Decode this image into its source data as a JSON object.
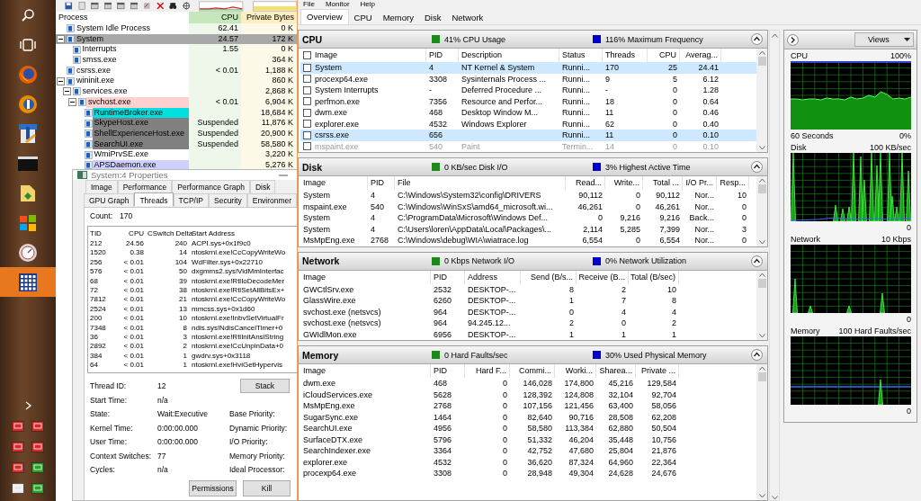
{
  "taskbar": {
    "items": [
      {
        "kind": "search",
        "selected": false
      },
      {
        "kind": "task-view",
        "selected": false
      },
      {
        "kind": "globe",
        "selected": false
      },
      {
        "kind": "round-logo",
        "selected": false
      },
      {
        "kind": "document",
        "selected": false
      },
      {
        "kind": "terminal",
        "selected": false
      },
      {
        "kind": "folder",
        "selected": false
      },
      {
        "kind": "tiles",
        "selected": false
      },
      {
        "kind": "circle",
        "selected": false
      },
      {
        "kind": "grid",
        "selected": true
      }
    ]
  },
  "process_explorer": {
    "columns": [
      "Process",
      "CPU",
      "Private Bytes"
    ],
    "processes": [
      {
        "name": "System Idle Process",
        "cpu": "62.41",
        "private_bytes": "0 K",
        "selected": false
      },
      {
        "name": "System",
        "cpu": "24.57",
        "private_bytes": "172 K",
        "selected": true,
        "expanded": true,
        "children": [
          {
            "name": "Interrupts",
            "cpu": "1.55",
            "private_bytes": "0 K",
            "selected": false
          },
          {
            "name": "smss.exe",
            "private_bytes": "364 K",
            "selected": false
          }
        ]
      },
      {
        "name": "csrss.exe",
        "cpu": "< 0.01",
        "private_bytes": "1,188 K",
        "selected": false
      },
      {
        "name": "wininit.exe",
        "private_bytes": "860 K",
        "selected": false,
        "expanded": true,
        "children": [
          {
            "name": "services.exe",
            "private_bytes": "2,868 K",
            "selected": false,
            "expanded": true,
            "children": [
              {
                "name": "svchost.exe",
                "cpu": "< 0.01",
                "private_bytes": "6,904 K",
                "selected": false,
                "color": "#ffd0d0",
                "expanded": true,
                "children": [
                  {
                    "name": "RuntimeBroker.exe",
                    "private_bytes": "18,684 K",
                    "selected": false,
                    "color": "#00e0e0"
                  },
                  {
                    "name": "SkypeHost.exe",
                    "cpu": "Suspended",
                    "private_bytes": "11,876 K",
                    "selected": false,
                    "color": "#808080"
                  },
                  {
                    "name": "ShellExperienceHost.exe",
                    "cpu": "Suspended",
                    "private_bytes": "20,900 K",
                    "selected": false,
                    "color": "#808080"
                  },
                  {
                    "name": "SearchUI.exe",
                    "cpu": "Suspended",
                    "private_bytes": "58,580 K",
                    "selected": false,
                    "color": "#808080"
                  },
                  {
                    "name": "WmiPrvSE.exe",
                    "private_bytes": "3,220 K",
                    "selected": false
                  },
                  {
                    "name": "APSDaemon.exe",
                    "private_bytes": "5,276 K",
                    "selected": false,
                    "color": "#d0d0ff"
                  }
                ]
              }
            ]
          }
        ]
      }
    ]
  },
  "properties_dialog": {
    "title": "System:4 Properties",
    "tab_rows": [
      [
        {
          "label": "Image",
          "selected": false
        },
        {
          "label": "Performance",
          "selected": false
        },
        {
          "label": "Performance Graph",
          "selected": false
        },
        {
          "label": "Disk",
          "selected": false
        }
      ],
      [
        {
          "label": "GPU Graph",
          "selected": false
        },
        {
          "label": "Threads",
          "selected": true
        },
        {
          "label": "TCP/IP",
          "selected": false
        },
        {
          "label": "Security",
          "selected": false
        },
        {
          "label": "Environmer",
          "selected": false
        }
      ]
    ],
    "count_label": "Count:",
    "count": "170",
    "thread_columns": [
      "TID",
      "CPU",
      "CSwitch Delta",
      "Start Address"
    ],
    "threads": [
      [
        "212",
        "24.56",
        "240",
        "ACPI.sys+0x1f9c0"
      ],
      [
        "1520",
        "0.38",
        "14",
        "ntoskrnl.exe!CcCopyWriteWo"
      ],
      [
        "256",
        "< 0.01",
        "104",
        "WdFilter.sys+0x22710"
      ],
      [
        "576",
        "< 0.01",
        "50",
        "dxgmms2.sys!VidMmInterfac"
      ],
      [
        "68",
        "< 0.01",
        "39",
        "ntoskrnl.exe!RtlIoDecodeMer"
      ],
      [
        "72",
        "< 0.01",
        "38",
        "ntoskrnl.exe!RtlSetAllBitsEx+"
      ],
      [
        "7812",
        "< 0.01",
        "21",
        "ntoskrnl.exe!CcCopyWriteWo"
      ],
      [
        "2524",
        "< 0.01",
        "13",
        "mmcss.sys+0x1d60"
      ],
      [
        "200",
        "< 0.01",
        "10",
        "ntoskrnl.exe!InbvSetVirtualFr"
      ],
      [
        "7348",
        "< 0.01",
        "8",
        "ndis.sys!NdisCancelTimer+0"
      ],
      [
        "36",
        "< 0.01",
        "3",
        "ntoskrnl.exe!RtlInitAnsiString"
      ],
      [
        "2892",
        "< 0.01",
        "2",
        "ntoskrnl.exe!CcUnpinData+0"
      ],
      [
        "384",
        "< 0.01",
        "1",
        "gwdrv.sys+0x3118"
      ],
      [
        "64",
        "< 0.01",
        "1",
        "ntoskrnl.exe!HviGetHypervis"
      ]
    ],
    "details": [
      {
        "label": "Thread ID:",
        "value": "12"
      },
      {
        "label": "Start Time:",
        "value": "n/a"
      },
      {
        "label": "State:",
        "value": "Wait:Executive"
      },
      {
        "label": "Kernel Time:",
        "value": "0:00:00.000"
      },
      {
        "label": "User Time:",
        "value": "0:00:00.000"
      },
      {
        "label": "Context Switches:",
        "value": "77"
      },
      {
        "label": "Cycles:",
        "value": "n/a"
      }
    ],
    "priority_labels": [
      "Base Priority:",
      "Dynamic Priority:",
      "I/O Priority:",
      "Memory Priority:",
      "Ideal Processor:"
    ],
    "stack_button": "Stack",
    "buttons": [
      "Permissions",
      "Kill"
    ]
  },
  "resource_monitor": {
    "menu": [
      "File",
      "Monitor",
      "Help"
    ],
    "tabs": [
      {
        "label": "Overview",
        "selected": true
      },
      {
        "label": "CPU",
        "selected": false
      },
      {
        "label": "Memory",
        "selected": false
      },
      {
        "label": "Disk",
        "selected": false
      },
      {
        "label": "Network",
        "selected": false
      }
    ],
    "sections": [
      {
        "kind": "cpu",
        "title": "CPU",
        "expanded": true,
        "header_checked": false,
        "indicators": [
          {
            "label": "41% CPU Usage",
            "color": "#1a8a1a"
          },
          {
            "label": "116% Maximum Frequency",
            "color": "#0000c8"
          }
        ],
        "columns": [
          "Image",
          "PID",
          "Description",
          "Status",
          "Threads",
          "CPU",
          "Averag..."
        ],
        "rows": [
          {
            "cells": [
              "System",
              "4",
              "NT Kernel & System",
              "Runni...",
              "170",
              "25",
              "24.41"
            ],
            "checked": false,
            "selected": true,
            "dimmed": false
          },
          {
            "cells": [
              "procexp64.exe",
              "3308",
              "Sysinternals Process ...",
              "Runni...",
              "9",
              "5",
              "6.12"
            ],
            "checked": false,
            "selected": false,
            "dimmed": false
          },
          {
            "cells": [
              "System Interrupts",
              "-",
              "Deferred Procedure ...",
              "Runni...",
              "-",
              "0",
              "1.28"
            ],
            "checked": false,
            "selected": false,
            "dimmed": false
          },
          {
            "cells": [
              "perfmon.exe",
              "7356",
              "Resource and Perfor...",
              "Runni...",
              "18",
              "0",
              "0.64"
            ],
            "checked": false,
            "selected": false,
            "dimmed": false
          },
          {
            "cells": [
              "dwm.exe",
              "468",
              "Desktop Window M...",
              "Runni...",
              "11",
              "0",
              "0.46"
            ],
            "checked": false,
            "selected": false,
            "dimmed": false
          },
          {
            "cells": [
              "explorer.exe",
              "4532",
              "Windows Explorer",
              "Runni...",
              "62",
              "0",
              "0.40"
            ],
            "checked": false,
            "selected": false,
            "dimmed": false
          },
          {
            "cells": [
              "csrss.exe",
              "656",
              null,
              "Runni...",
              "11",
              "0",
              "0.10"
            ],
            "checked": false,
            "selected": true,
            "dimmed": false
          },
          {
            "cells": [
              "mspaint.exe",
              "540",
              "Paint",
              "Termin...",
              "14",
              "0",
              "0.10"
            ],
            "checked": false,
            "selected": false,
            "dimmed": true
          }
        ]
      },
      {
        "kind": "disk",
        "title": "Disk",
        "expanded": true,
        "indicators": [
          {
            "label": "0 KB/sec Disk I/O",
            "color": "#1a8a1a"
          },
          {
            "label": "3% Highest Active Time",
            "color": "#0000c8"
          }
        ],
        "columns": [
          "Image",
          "PID",
          "File",
          "Read...",
          "Write...",
          "Total ...",
          "I/O Pr...",
          "Resp..."
        ],
        "rows": [
          {
            "cells": [
              "System",
              "4",
              "C:\\Windows\\System32\\config\\DRIVERS",
              "90,112",
              "0",
              "90,112",
              "Nor...",
              "10"
            ]
          },
          {
            "cells": [
              "mspaint.exe",
              "540",
              "C:\\Windows\\WinSxS\\amd64_microsoft.wi...",
              "46,261",
              "0",
              "46,261",
              "Nor...",
              "0"
            ]
          },
          {
            "cells": [
              "System",
              "4",
              "C:\\ProgramData\\Microsoft\\Windows Def...",
              "0",
              "9,216",
              "9,216",
              "Back...",
              "0"
            ]
          },
          {
            "cells": [
              "System",
              "4",
              "C:\\Users\\loren\\AppData\\Local\\Packages\\...",
              "2,114",
              "5,285",
              "7,399",
              "Nor...",
              "3"
            ]
          },
          {
            "cells": [
              "MsMpEng.exe",
              "2768",
              "C:\\Windows\\debug\\WIA\\wiatrace.log",
              "6,554",
              "0",
              "6,554",
              "Nor...",
              "0"
            ]
          }
        ]
      },
      {
        "kind": "network",
        "title": "Network",
        "expanded": true,
        "indicators": [
          {
            "label": "0 Kbps Network I/O",
            "color": "#1a8a1a"
          },
          {
            "label": "0% Network Utilization",
            "color": "#0000c8"
          }
        ],
        "columns": [
          "Image",
          "PID",
          "Address",
          "Send (B/s...",
          "Receive (B...",
          "Total (B/sec)"
        ],
        "rows": [
          {
            "cells": [
              "GWCtlSrv.exe",
              "2532",
              "DESKTOP-...",
              "8",
              "2",
              "10"
            ]
          },
          {
            "cells": [
              "GlassWire.exe",
              "6260",
              "DESKTOP-...",
              "1",
              "7",
              "8"
            ]
          },
          {
            "cells": [
              "svchost.exe (netsvcs)",
              "964",
              "DESKTOP-...",
              "0",
              "4",
              "4"
            ]
          },
          {
            "cells": [
              "svchost.exe (netsvcs)",
              "964",
              "94.245.12...",
              "2",
              "0",
              "2"
            ]
          },
          {
            "cells": [
              "GWIdlMon.exe",
              "6956",
              "DESKTOP-...",
              "1",
              "1",
              "1"
            ]
          }
        ]
      },
      {
        "kind": "memory",
        "title": "Memory",
        "expanded": true,
        "indicators": [
          {
            "label": "0 Hard Faults/sec",
            "color": "#1a8a1a"
          },
          {
            "label": "30% Used Physical Memory",
            "color": "#0000c8"
          }
        ],
        "columns": [
          "Image",
          "PID",
          "Hard F...",
          "Commi...",
          "Worki...",
          "Sharea...",
          "Private ..."
        ],
        "rows": [
          {
            "cells": [
              "dwm.exe",
              "468",
              "0",
              "146,028",
              "174,800",
              "45,216",
              "129,584"
            ]
          },
          {
            "cells": [
              "iCloudServices.exe",
              "5628",
              "0",
              "128,392",
              "124,808",
              "32,104",
              "92,704"
            ]
          },
          {
            "cells": [
              "MsMpEng.exe",
              "2768",
              "0",
              "107,156",
              "121,456",
              "63,400",
              "58,056"
            ]
          },
          {
            "cells": [
              "SugarSync.exe",
              "1464",
              "0",
              "82,640",
              "90,716",
              "28,508",
              "62,208"
            ]
          },
          {
            "cells": [
              "SearchUI.exe",
              "4956",
              "0",
              "58,580",
              "113,384",
              "62,880",
              "50,504"
            ]
          },
          {
            "cells": [
              "SurfaceDTX.exe",
              "5796",
              "0",
              "51,332",
              "46,204",
              "35,448",
              "10,756"
            ]
          },
          {
            "cells": [
              "SearchIndexer.exe",
              "3364",
              "0",
              "42,752",
              "47,680",
              "25,804",
              "21,876"
            ]
          },
          {
            "cells": [
              "explorer.exe",
              "4532",
              "0",
              "36,620",
              "87,324",
              "64,960",
              "22,364"
            ]
          },
          {
            "cells": [
              "procexp64.exe",
              "3308",
              "0",
              "28,948",
              "49,304",
              "24,628",
              "24,676"
            ]
          }
        ]
      }
    ],
    "views_button": "Views",
    "graphs": [
      {
        "kind": "cpu",
        "title": "CPU",
        "max": "100%",
        "time": "60 Seconds",
        "min": "0%"
      },
      {
        "kind": "disk",
        "title": "Disk",
        "max": "100 KB/sec",
        "min": "0"
      },
      {
        "kind": "network",
        "title": "Network",
        "max": "10 Kbps",
        "min": "0"
      },
      {
        "kind": "memory",
        "title": "Memory",
        "max": "100 Hard Faults/sec",
        "min": "0"
      }
    ]
  }
}
